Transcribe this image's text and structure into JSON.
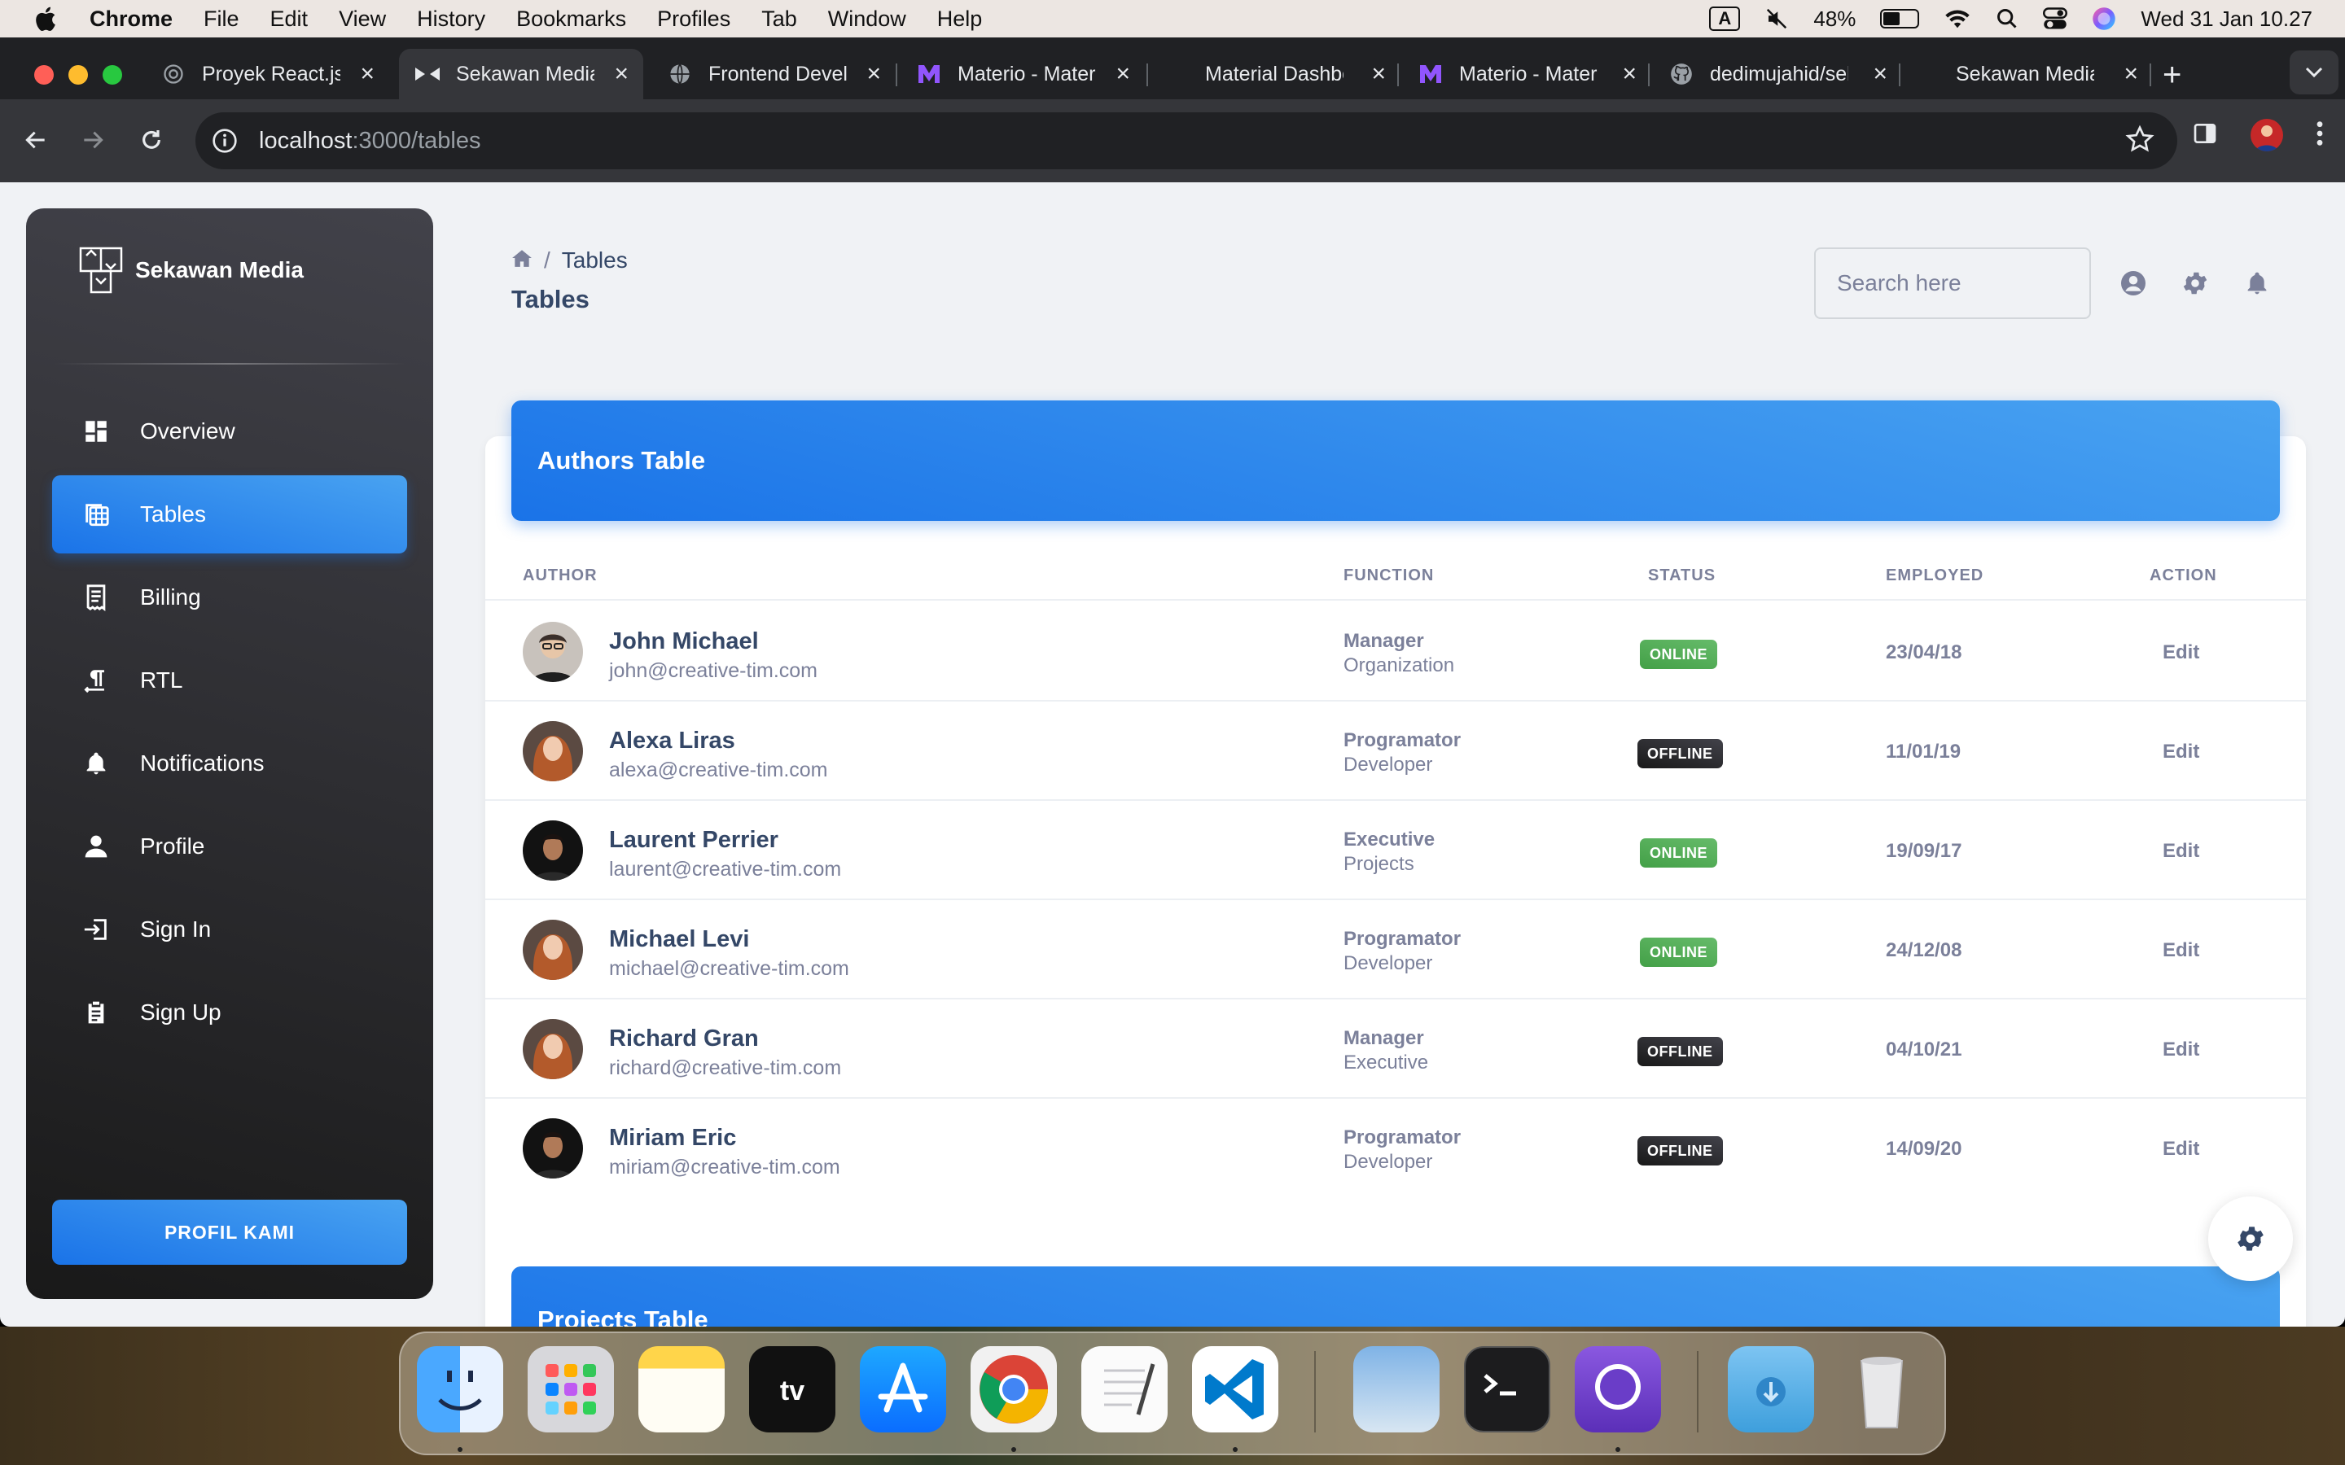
{
  "menubar": {
    "app": "Chrome",
    "items": [
      "File",
      "Edit",
      "View",
      "History",
      "Bookmarks",
      "Profiles",
      "Tab",
      "Window",
      "Help"
    ],
    "input_source": "A",
    "battery": "48%",
    "battery_level": 0.48,
    "datetime": "Wed 31 Jan  10.27"
  },
  "browser": {
    "tabs": [
      {
        "title": "Proyek React.js",
        "icon": "openai-icon"
      },
      {
        "title": "Sekawan Media",
        "icon": "sekawan-icon",
        "active": true
      },
      {
        "title": "Frontend Developer",
        "icon": "globe-icon"
      },
      {
        "title": "Materio - Materio",
        "icon": "materio-icon"
      },
      {
        "title": "Material Dashboard",
        "icon": "none"
      },
      {
        "title": "Materio - Materio",
        "icon": "materio-icon"
      },
      {
        "title": "dedimujahid/sekawan",
        "icon": "github-icon"
      },
      {
        "title": "Sekawan Media",
        "icon": "none"
      }
    ],
    "url_host": "localhost",
    "url_rest": ":3000/tables"
  },
  "sidebar": {
    "brand": "Sekawan Media",
    "items": [
      {
        "label": "Overview",
        "icon": "dashboard-icon"
      },
      {
        "label": "Tables",
        "icon": "table-icon",
        "active": true
      },
      {
        "label": "Billing",
        "icon": "receipt-icon"
      },
      {
        "label": "RTL",
        "icon": "paragraph-icon"
      },
      {
        "label": "Notifications",
        "icon": "bell-icon"
      },
      {
        "label": "Profile",
        "icon": "person-icon"
      },
      {
        "label": "Sign In",
        "icon": "login-icon"
      },
      {
        "label": "Sign Up",
        "icon": "clipboard-icon"
      }
    ],
    "cta": "PROFIL KAMI"
  },
  "header": {
    "breadcrumb": "Tables",
    "title": "Tables",
    "search_placeholder": "Search here"
  },
  "authors_table": {
    "title": "Authors Table",
    "columns": [
      "AUTHOR",
      "FUNCTION",
      "STATUS",
      "EMPLOYED",
      "ACTION"
    ],
    "rows": [
      {
        "name": "John Michael",
        "email": "john@creative-tim.com",
        "role": "Manager",
        "dept": "Organization",
        "status": "ONLINE",
        "employed": "23/04/18",
        "action": "Edit"
      },
      {
        "name": "Alexa Liras",
        "email": "alexa@creative-tim.com",
        "role": "Programator",
        "dept": "Developer",
        "status": "OFFLINE",
        "employed": "11/01/19",
        "action": "Edit"
      },
      {
        "name": "Laurent Perrier",
        "email": "laurent@creative-tim.com",
        "role": "Executive",
        "dept": "Projects",
        "status": "ONLINE",
        "employed": "19/09/17",
        "action": "Edit"
      },
      {
        "name": "Michael Levi",
        "email": "michael@creative-tim.com",
        "role": "Programator",
        "dept": "Developer",
        "status": "ONLINE",
        "employed": "24/12/08",
        "action": "Edit"
      },
      {
        "name": "Richard Gran",
        "email": "richard@creative-tim.com",
        "role": "Manager",
        "dept": "Executive",
        "status": "OFFLINE",
        "employed": "04/10/21",
        "action": "Edit"
      },
      {
        "name": "Miriam Eric",
        "email": "miriam@creative-tim.com",
        "role": "Programator",
        "dept": "Developer",
        "status": "OFFLINE",
        "employed": "14/09/20",
        "action": "Edit"
      }
    ]
  },
  "projects_table": {
    "title": "Projects Table"
  },
  "colors": {
    "accent": "#1a73e8",
    "online": "#4caf50",
    "offline": "#212121",
    "text_dark": "#344767",
    "text_muted": "#7b809a"
  }
}
